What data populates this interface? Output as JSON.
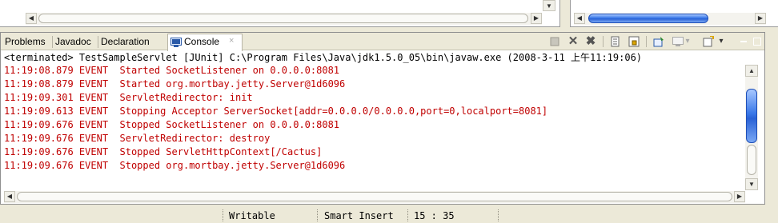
{
  "tabs": [
    {
      "label": "Problems"
    },
    {
      "label": "Javadoc"
    },
    {
      "label": "Declaration"
    },
    {
      "label": "Console",
      "close": "×"
    }
  ],
  "console": {
    "process": "<terminated> TestSampleServlet [JUnit] C:\\Program Files\\Java\\jdk1.5.0_05\\bin\\javaw.exe (2008-3-11 上午11:19:06)",
    "lines": [
      "11:19:08.879 EVENT  Started SocketListener on 0.0.0.0:8081",
      "11:19:08.879 EVENT  Started org.mortbay.jetty.Server@1d6096",
      "11:19:09.301 EVENT  ServletRedirector: init",
      "11:19:09.613 EVENT  Stopping Acceptor ServerSocket[addr=0.0.0.0/0.0.0.0,port=0,localport=8081]",
      "11:19:09.676 EVENT  Stopped SocketListener on 0.0.0.0:8081",
      "11:19:09.676 EVENT  ServletRedirector: destroy",
      "11:19:09.676 EVENT  Stopped ServletHttpContext[/Cactus]",
      "11:19:09.676 EVENT  Stopped org.mortbay.jetty.Server@1d6096"
    ],
    "log_color": "#c00000"
  },
  "status": {
    "writable": "Writable",
    "insert_mode": "Smart Insert",
    "position": "15 : 35"
  },
  "icons": {
    "console_tab": "console-icon",
    "arrow_left": "◀",
    "arrow_right": "▶",
    "arrow_up": "▲",
    "arrow_down": "▼",
    "dropdown": "▾"
  }
}
